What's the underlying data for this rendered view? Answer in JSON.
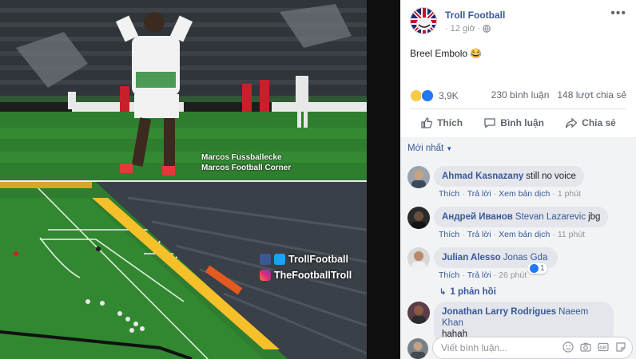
{
  "photo": {
    "credit_line1": "Marcos Fussballecke",
    "credit_line2": "Marcos Football Corner",
    "brand_twitter": "TrollFootball",
    "brand_instagram": "TheFootballTroll"
  },
  "post": {
    "page_name": "Troll Football",
    "time": "12 giờ",
    "text": "Breel Embolo 😂",
    "reactions_count": "3,9K",
    "comments_count": "230 bình luận",
    "shares_count": "148 lượt chia sẻ"
  },
  "actions": {
    "like": "Thích",
    "comment": "Bình luận",
    "share": "Chia sẻ"
  },
  "comments_sort": "Mới nhất",
  "comments": [
    {
      "author": "Ahmad Kasnazany",
      "mention": "",
      "text": "still no voice",
      "like_label": "Thích",
      "reply_label": "Trả lời",
      "translate_label": "Xem bản dịch",
      "time": "1 phút"
    },
    {
      "author": "Андрей Иванов",
      "mention": "Stevan Lazarevic",
      "text": "jbg",
      "like_label": "Thích",
      "reply_label": "Trả lời",
      "translate_label": "Xem bản dịch",
      "time": "11 phút"
    },
    {
      "author": "Julian Alesso",
      "mention": "",
      "text": "Jonas Gda",
      "like_label": "Thích",
      "reply_label": "Trả lời",
      "time": "26 phút",
      "likes": "1",
      "replies": "1 phản hồi"
    },
    {
      "author": "Jonathan Larry Rodrigues",
      "mention": "Naeem Khan",
      "text": "hahah"
    }
  ],
  "composer": {
    "placeholder": "Viết bình luận..."
  },
  "colors": {
    "link_blue": "#385898",
    "meta_gray": "#90949c",
    "bubble_bg": "#e4e6eb",
    "comments_bg": "#f2f3f5",
    "pitch_green": "#2f7d2f",
    "kit_red": "#c8202a"
  },
  "icons": {
    "globe": "globe-icon",
    "more": "more-options-icon",
    "like": "thumbs-up-icon",
    "comment": "speech-bubble-icon",
    "share": "share-arrow-icon",
    "emoji": "emoji-icon",
    "camera": "camera-icon",
    "gif": "gif-icon",
    "sticker": "sticker-icon"
  }
}
